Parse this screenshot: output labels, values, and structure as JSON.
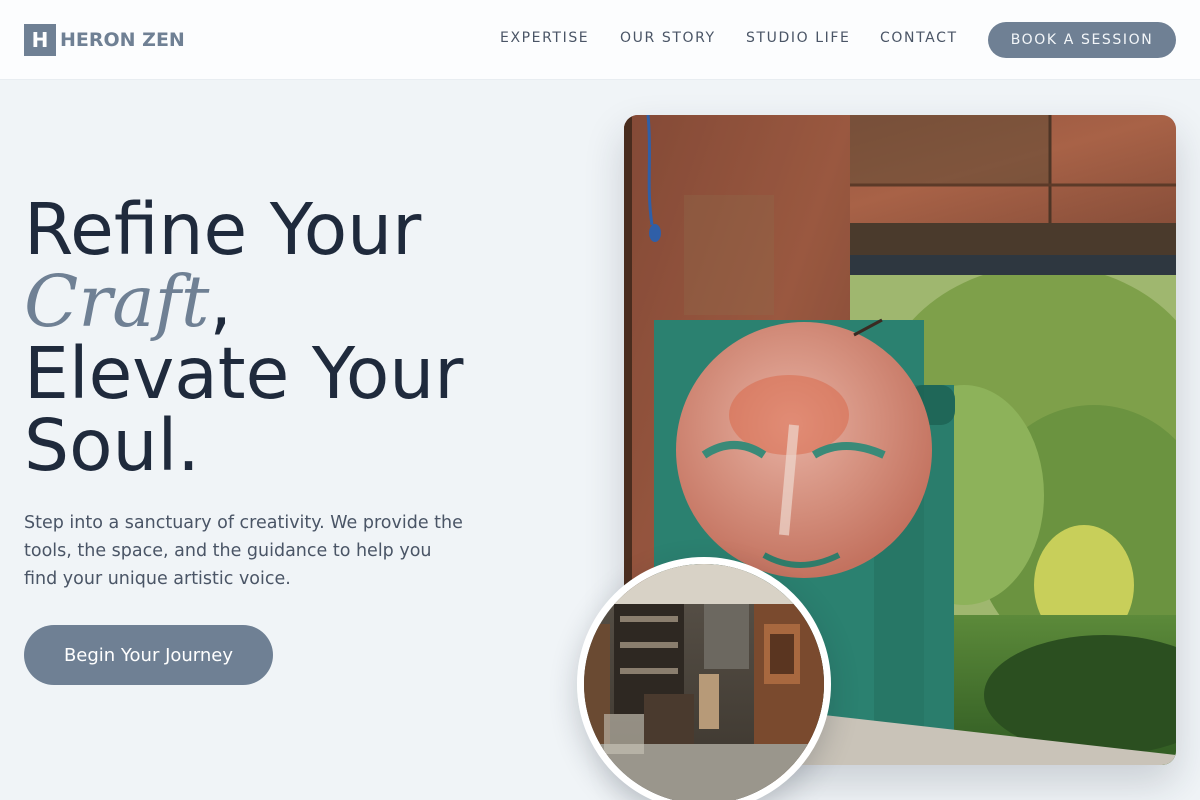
{
  "brand": {
    "mark": "H",
    "name": "HERON ZEN"
  },
  "nav": {
    "links": [
      "EXPERTISE",
      "OUR STORY",
      "STUDIO LIFE",
      "CONTACT"
    ],
    "cta": "BOOK A SESSION"
  },
  "hero": {
    "headline_line1": "Refine Your",
    "headline_em": "Craft",
    "headline_comma": ",",
    "headline_line3": "Elevate Your",
    "headline_line4": "Soul.",
    "subtext": "Step into a sanctuary of creativity. We provide the tools, the space, and the guidance to help you find your unique artistic voice.",
    "button": "Begin Your Journey"
  },
  "images": {
    "main": "outdoor-painted-face-sculpture-photo",
    "inset": "studio-interior-photo"
  },
  "colors": {
    "accent": "#6f8094",
    "heading": "#1f2a3c",
    "body_text": "#4a5566",
    "background": "#f0f4f7",
    "header_bg": "#fcfdfe"
  }
}
